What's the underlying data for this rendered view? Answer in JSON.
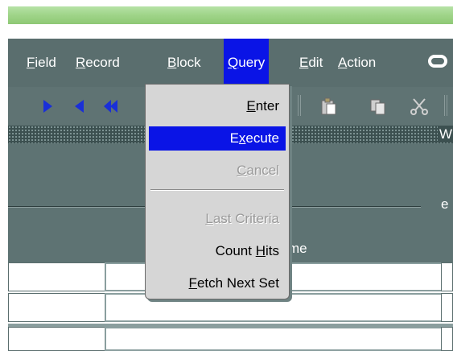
{
  "menubar": {
    "items": [
      {
        "pre": "",
        "mn": "F",
        "post": "ield"
      },
      {
        "pre": "",
        "mn": "R",
        "post": "ecord"
      },
      {
        "pre": "",
        "mn": "B",
        "post": "lock"
      },
      {
        "pre": "",
        "mn": "Q",
        "post": "uery"
      },
      {
        "pre": "",
        "mn": "E",
        "post": "dit"
      },
      {
        "pre": "",
        "mn": "A",
        "post": "ction"
      }
    ],
    "active_item": "Query"
  },
  "query_menu": {
    "items": [
      {
        "pre": "",
        "mn": "E",
        "post": "nter",
        "state": "enabled"
      },
      {
        "pre": "E",
        "mn": "x",
        "post": "ecute",
        "state": "selected"
      },
      {
        "pre": "",
        "mn": "C",
        "post": "ancel",
        "state": "disabled"
      },
      {
        "pre": "",
        "mn": "L",
        "post": "ast Criteria",
        "state": "disabled"
      },
      {
        "pre": "Count ",
        "mn": "H",
        "post": "its",
        "state": "enabled"
      },
      {
        "pre": "",
        "mn": "F",
        "post": "etch Next Set",
        "state": "enabled"
      }
    ]
  },
  "status_strip": {
    "label": "W"
  },
  "form": {
    "frame_label": "e",
    "column_header": "me"
  },
  "toolbar": {
    "icons": [
      "next-record-icon",
      "previous-record-icon",
      "previous-block-icon",
      "paste-icon",
      "copy-icon",
      "cut-icon"
    ]
  },
  "colors": {
    "menu_highlight": "#0a14e6",
    "menubar_bg": "#5a6e6e",
    "title_green": "#9fd488",
    "menu_bg": "#d6d6d6"
  }
}
